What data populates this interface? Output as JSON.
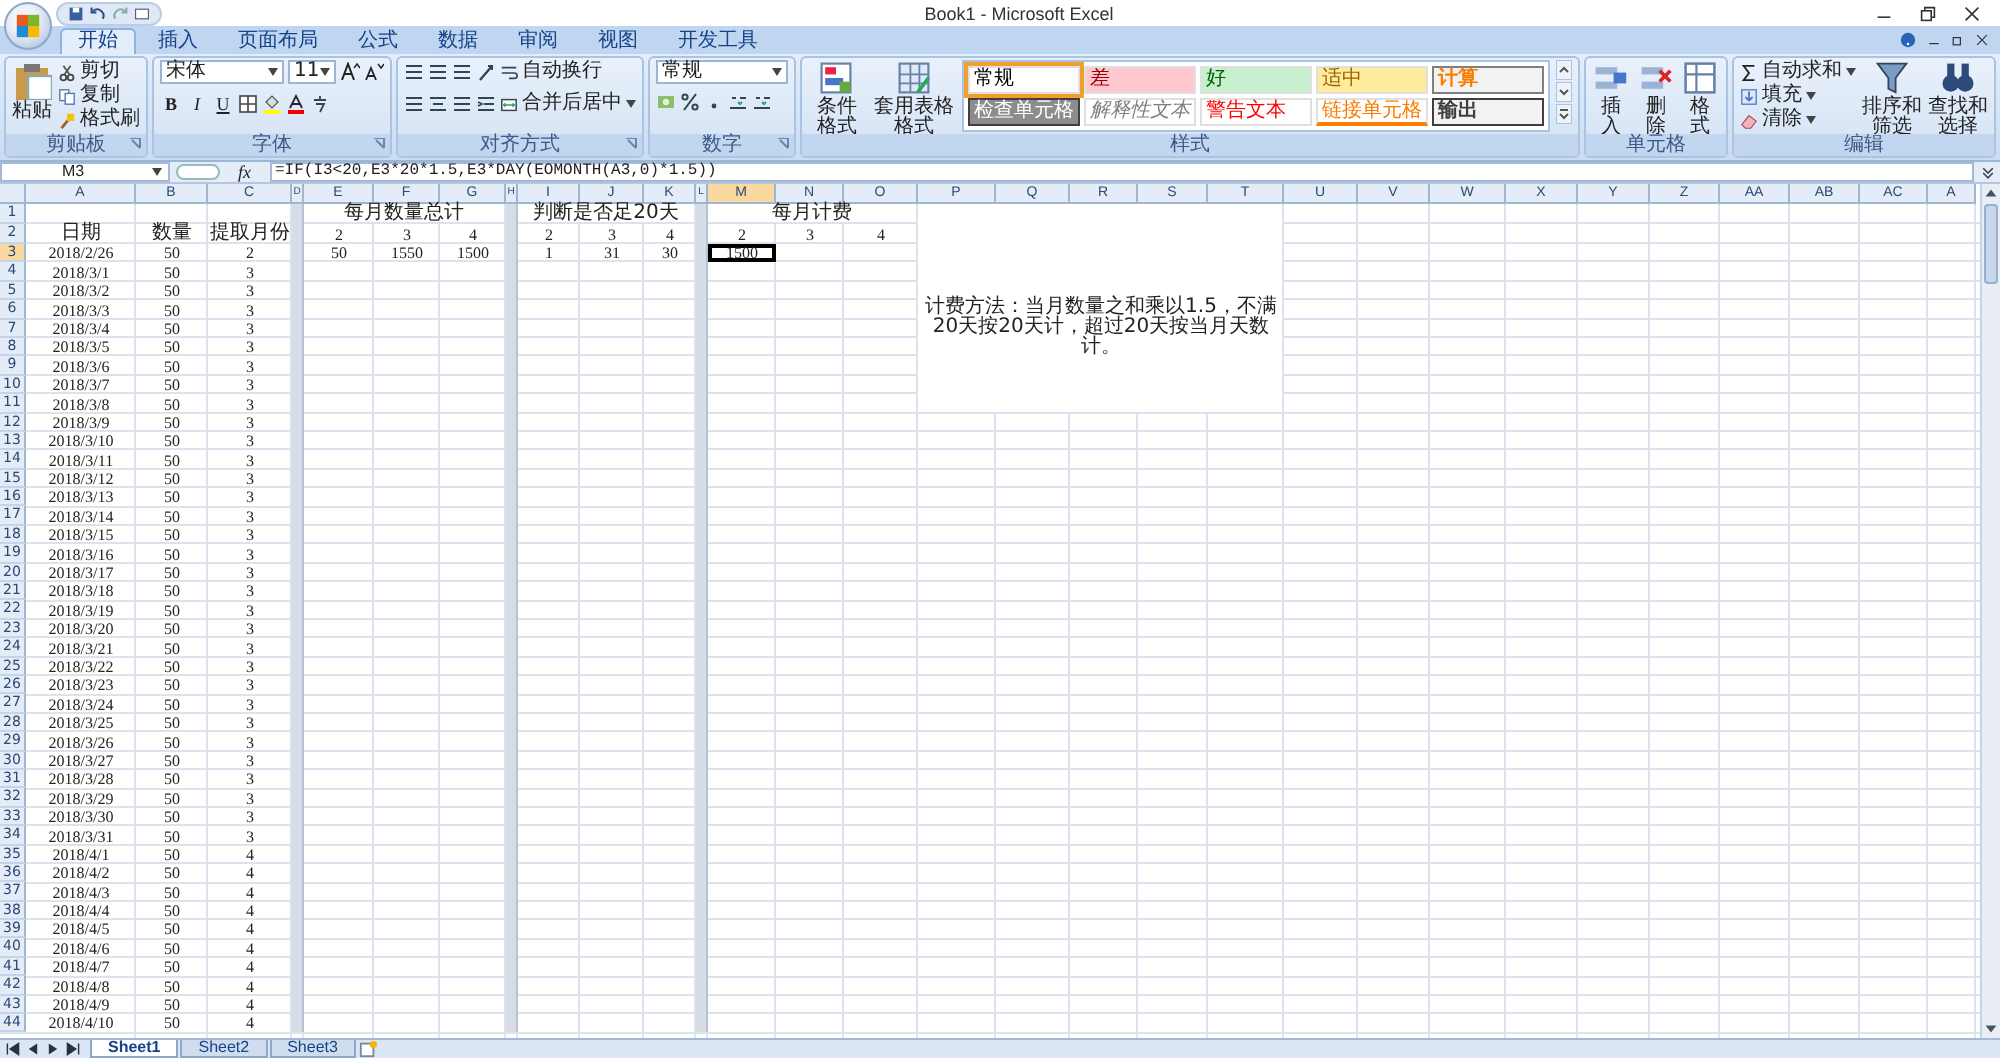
{
  "window": {
    "title": "Book1 - Microsoft Excel"
  },
  "tabs": [
    {
      "label": "开始",
      "selected": true
    },
    {
      "label": "插入",
      "selected": false
    },
    {
      "label": "页面布局",
      "selected": false
    },
    {
      "label": "公式",
      "selected": false
    },
    {
      "label": "数据",
      "selected": false
    },
    {
      "label": "审阅",
      "selected": false
    },
    {
      "label": "视图",
      "selected": false
    },
    {
      "label": "开发工具",
      "selected": false
    }
  ],
  "ribbon": {
    "groups": [
      {
        "kind": "clipboard",
        "label": "剪贴板",
        "big": "粘贴",
        "small": [
          "剪切",
          "复制",
          "格式刷"
        ]
      },
      {
        "kind": "font",
        "label": "字体",
        "font": "宋体",
        "size": "11",
        "toggles": [
          "B",
          "I",
          "U"
        ]
      },
      {
        "kind": "alignment",
        "label": "对齐方式",
        "wrap": "自动换行",
        "merge": "合并后居中"
      },
      {
        "kind": "number",
        "label": "数字",
        "format": "常规"
      },
      {
        "kind": "styles",
        "label": "样式",
        "buttons": [
          "条件格式",
          "套用表格格式"
        ],
        "gallery": [
          {
            "label": "常规",
            "kind": "normal",
            "selected": true
          },
          {
            "label": "差",
            "kind": "bad",
            "selected": false
          },
          {
            "label": "好",
            "kind": "good",
            "selected": false
          },
          {
            "label": "适中",
            "kind": "neutral",
            "selected": false
          },
          {
            "label": "计算",
            "kind": "calculation",
            "selected": false
          },
          {
            "label": "检查单元格",
            "kind": "check",
            "selected": false
          },
          {
            "label": "解释性文本",
            "kind": "explanatory",
            "selected": false
          },
          {
            "label": "警告文本",
            "kind": "warning",
            "selected": false
          },
          {
            "label": "链接单元格",
            "kind": "linked",
            "selected": false
          },
          {
            "label": "输出",
            "kind": "output",
            "selected": false
          }
        ]
      },
      {
        "kind": "cells",
        "label": "单元格",
        "buttons": [
          "插入",
          "删除",
          "格式"
        ]
      },
      {
        "kind": "editing",
        "label": "编辑",
        "small": [
          "自动求和",
          "填充",
          "清除"
        ],
        "buttons": [
          "排序和筛选",
          "查找和选择"
        ]
      }
    ]
  },
  "formula_bar": {
    "name_box": "M3",
    "function_label": "fx",
    "formula": "=IF(I3<20,E3*20*1.5,E3*DAY(EOMONTH(A3,0)*1.5))"
  },
  "sheet": {
    "columns": [
      {
        "label": "A",
        "selected": false,
        "shaded": false
      },
      {
        "label": "B",
        "selected": false,
        "shaded": false
      },
      {
        "label": "C",
        "selected": false,
        "shaded": false
      },
      {
        "label": "D",
        "selected": false,
        "shaded": true
      },
      {
        "label": "E",
        "selected": false,
        "shaded": false
      },
      {
        "label": "F",
        "selected": false,
        "shaded": false
      },
      {
        "label": "G",
        "selected": false,
        "shaded": false
      },
      {
        "label": "H",
        "selected": false,
        "shaded": true
      },
      {
        "label": "I",
        "selected": false,
        "shaded": false
      },
      {
        "label": "J",
        "selected": false,
        "shaded": false
      },
      {
        "label": "K",
        "selected": false,
        "shaded": false
      },
      {
        "label": "L",
        "selected": false,
        "shaded": true
      },
      {
        "label": "M",
        "selected": true,
        "shaded": false
      },
      {
        "label": "N",
        "selected": false,
        "shaded": false
      },
      {
        "label": "O",
        "selected": false,
        "shaded": false
      },
      {
        "label": "P",
        "selected": false,
        "shaded": false
      },
      {
        "label": "Q",
        "selected": false,
        "shaded": false
      },
      {
        "label": "R",
        "selected": false,
        "shaded": false
      },
      {
        "label": "S",
        "selected": false,
        "shaded": false
      },
      {
        "label": "T",
        "selected": false,
        "shaded": false
      },
      {
        "label": "U",
        "selected": false,
        "shaded": false
      },
      {
        "label": "V",
        "selected": false,
        "shaded": false
      },
      {
        "label": "W",
        "selected": false,
        "shaded": false
      },
      {
        "label": "X",
        "selected": false,
        "shaded": false
      },
      {
        "label": "Y",
        "selected": false,
        "shaded": false
      },
      {
        "label": "Z",
        "selected": false,
        "shaded": false
      },
      {
        "label": "AA",
        "selected": false,
        "shaded": false
      },
      {
        "label": "AB",
        "selected": false,
        "shaded": false
      },
      {
        "label": "AC",
        "selected": false,
        "shaded": false
      },
      {
        "label": "A",
        "selected": false,
        "shaded": false
      }
    ],
    "rows": [
      {
        "label": "1",
        "selected": false,
        "cells": [
          "",
          "",
          "",
          "",
          "每月数量总计",
          "",
          "",
          "",
          "判断是否足20天",
          "",
          "",
          "",
          "",
          "每月计费"
        ]
      },
      {
        "label": "2",
        "selected": false,
        "cells": [
          "日期",
          "数量",
          "提取月份",
          "",
          "2",
          "3",
          "4",
          "",
          "2",
          "3",
          "4",
          "",
          "2",
          "3",
          "4"
        ]
      },
      {
        "label": "3",
        "selected": true,
        "cells": [
          "2018/2/26",
          "50",
          "2",
          "",
          "50",
          "1550",
          "1500",
          "",
          "1",
          "31",
          "30",
          "",
          "1500"
        ]
      },
      {
        "label": "4",
        "selected": false,
        "cells": [
          "2018/3/1",
          "50",
          "3"
        ]
      },
      {
        "label": "5",
        "selected": false,
        "cells": [
          "2018/3/2",
          "50",
          "3"
        ]
      },
      {
        "label": "6",
        "selected": false,
        "cells": [
          "2018/3/3",
          "50",
          "3",
          "",
          "",
          "",
          "",
          "",
          "",
          "",
          "",
          "",
          "",
          "",
          "",
          "计费方法：当月数量之和乘以1.5，不满20天按20天计，超过20天按当月天数计。"
        ]
      },
      {
        "label": "7",
        "selected": false,
        "cells": [
          "2018/3/4",
          "50",
          "3"
        ]
      },
      {
        "label": "8",
        "selected": false,
        "cells": [
          "2018/3/5",
          "50",
          "3"
        ]
      },
      {
        "label": "9",
        "selected": false,
        "cells": [
          "2018/3/6",
          "50",
          "3"
        ]
      },
      {
        "label": "10",
        "selected": false,
        "cells": [
          "2018/3/7",
          "50",
          "3"
        ]
      },
      {
        "label": "11",
        "selected": false,
        "cells": [
          "2018/3/8",
          "50",
          "3"
        ]
      },
      {
        "label": "12",
        "selected": false,
        "cells": [
          "2018/3/9",
          "50",
          "3"
        ]
      },
      {
        "label": "13",
        "selected": false,
        "cells": [
          "2018/3/10",
          "50",
          "3"
        ]
      },
      {
        "label": "14",
        "selected": false,
        "cells": [
          "2018/3/11",
          "50",
          "3"
        ]
      },
      {
        "label": "15",
        "selected": false,
        "cells": [
          "2018/3/12",
          "50",
          "3"
        ]
      },
      {
        "label": "16",
        "selected": false,
        "cells": [
          "2018/3/13",
          "50",
          "3"
        ]
      },
      {
        "label": "17",
        "selected": false,
        "cells": [
          "2018/3/14",
          "50",
          "3"
        ]
      },
      {
        "label": "18",
        "selected": false,
        "cells": [
          "2018/3/15",
          "50",
          "3"
        ]
      },
      {
        "label": "19",
        "selected": false,
        "cells": [
          "2018/3/16",
          "50",
          "3"
        ]
      },
      {
        "label": "20",
        "selected": false,
        "cells": [
          "2018/3/17",
          "50",
          "3"
        ]
      },
      {
        "label": "21",
        "selected": false,
        "cells": [
          "2018/3/18",
          "50",
          "3"
        ]
      },
      {
        "label": "22",
        "selected": false,
        "cells": [
          "2018/3/19",
          "50",
          "3"
        ]
      },
      {
        "label": "23",
        "selected": false,
        "cells": [
          "2018/3/20",
          "50",
          "3"
        ]
      },
      {
        "label": "24",
        "selected": false,
        "cells": [
          "2018/3/21",
          "50",
          "3"
        ]
      },
      {
        "label": "25",
        "selected": false,
        "cells": [
          "2018/3/22",
          "50",
          "3"
        ]
      },
      {
        "label": "26",
        "selected": false,
        "cells": [
          "2018/3/23",
          "50",
          "3"
        ]
      },
      {
        "label": "27",
        "selected": false,
        "cells": [
          "2018/3/24",
          "50",
          "3"
        ]
      },
      {
        "label": "28",
        "selected": false,
        "cells": [
          "2018/3/25",
          "50",
          "3"
        ]
      },
      {
        "label": "29",
        "selected": false,
        "cells": [
          "2018/3/26",
          "50",
          "3"
        ]
      },
      {
        "label": "30",
        "selected": false,
        "cells": [
          "2018/3/27",
          "50",
          "3"
        ]
      },
      {
        "label": "31",
        "selected": false,
        "cells": [
          "2018/3/28",
          "50",
          "3"
        ]
      },
      {
        "label": "32",
        "selected": false,
        "cells": [
          "2018/3/29",
          "50",
          "3"
        ]
      },
      {
        "label": "33",
        "selected": false,
        "cells": [
          "2018/3/30",
          "50",
          "3"
        ]
      },
      {
        "label": "34",
        "selected": false,
        "cells": [
          "2018/3/31",
          "50",
          "3"
        ]
      },
      {
        "label": "35",
        "selected": false,
        "cells": [
          "2018/4/1",
          "50",
          "4"
        ]
      },
      {
        "label": "36",
        "selected": false,
        "cells": [
          "2018/4/2",
          "50",
          "4"
        ]
      },
      {
        "label": "37",
        "selected": false,
        "cells": [
          "2018/4/3",
          "50",
          "4"
        ]
      },
      {
        "label": "38",
        "selected": false,
        "cells": [
          "2018/4/4",
          "50",
          "4"
        ]
      },
      {
        "label": "39",
        "selected": false,
        "cells": [
          "2018/4/5",
          "50",
          "4"
        ]
      },
      {
        "label": "40",
        "selected": false,
        "cells": [
          "2018/4/6",
          "50",
          "4"
        ]
      },
      {
        "label": "41",
        "selected": false,
        "cells": [
          "2018/4/7",
          "50",
          "4"
        ]
      },
      {
        "label": "42",
        "selected": false,
        "cells": [
          "2018/4/8",
          "50",
          "4"
        ]
      },
      {
        "label": "43",
        "selected": false,
        "cells": [
          "2018/4/9",
          "50",
          "4"
        ]
      },
      {
        "label": "44",
        "selected": false,
        "cells": [
          "2018/4/10",
          "50",
          "4"
        ]
      }
    ]
  },
  "sheet_tabs": [
    {
      "label": "Sheet1",
      "selected": true
    },
    {
      "label": "Sheet2",
      "selected": false
    },
    {
      "label": "Sheet3",
      "selected": false
    }
  ]
}
